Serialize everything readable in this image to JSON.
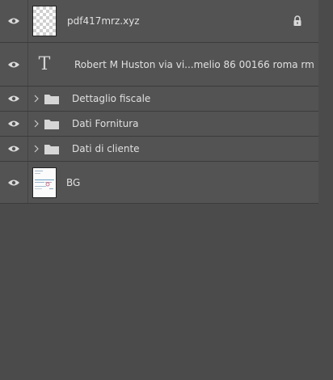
{
  "layers": [
    {
      "name": "pdf417mrz.xyz",
      "kind": "smart-object",
      "locked": true,
      "icon": "transparent-thumbnail"
    },
    {
      "name": "Robert M Huston via vi...melio 86 00166 roma rm",
      "kind": "text",
      "icon": "type-tool-icon",
      "glyph": "T"
    },
    {
      "name": "Dettaglio fiscale",
      "kind": "group",
      "icon": "folder-icon"
    },
    {
      "name": "Dati Fornitura",
      "kind": "group",
      "icon": "folder-icon"
    },
    {
      "name": "Dati di cliente",
      "kind": "group",
      "icon": "folder-icon"
    },
    {
      "name": "BG",
      "kind": "image",
      "icon": "document-thumbnail"
    }
  ],
  "colors": {
    "panel_bg": "#4b4b4b",
    "row_bg": "#535353",
    "text": "#e0e0e0"
  }
}
